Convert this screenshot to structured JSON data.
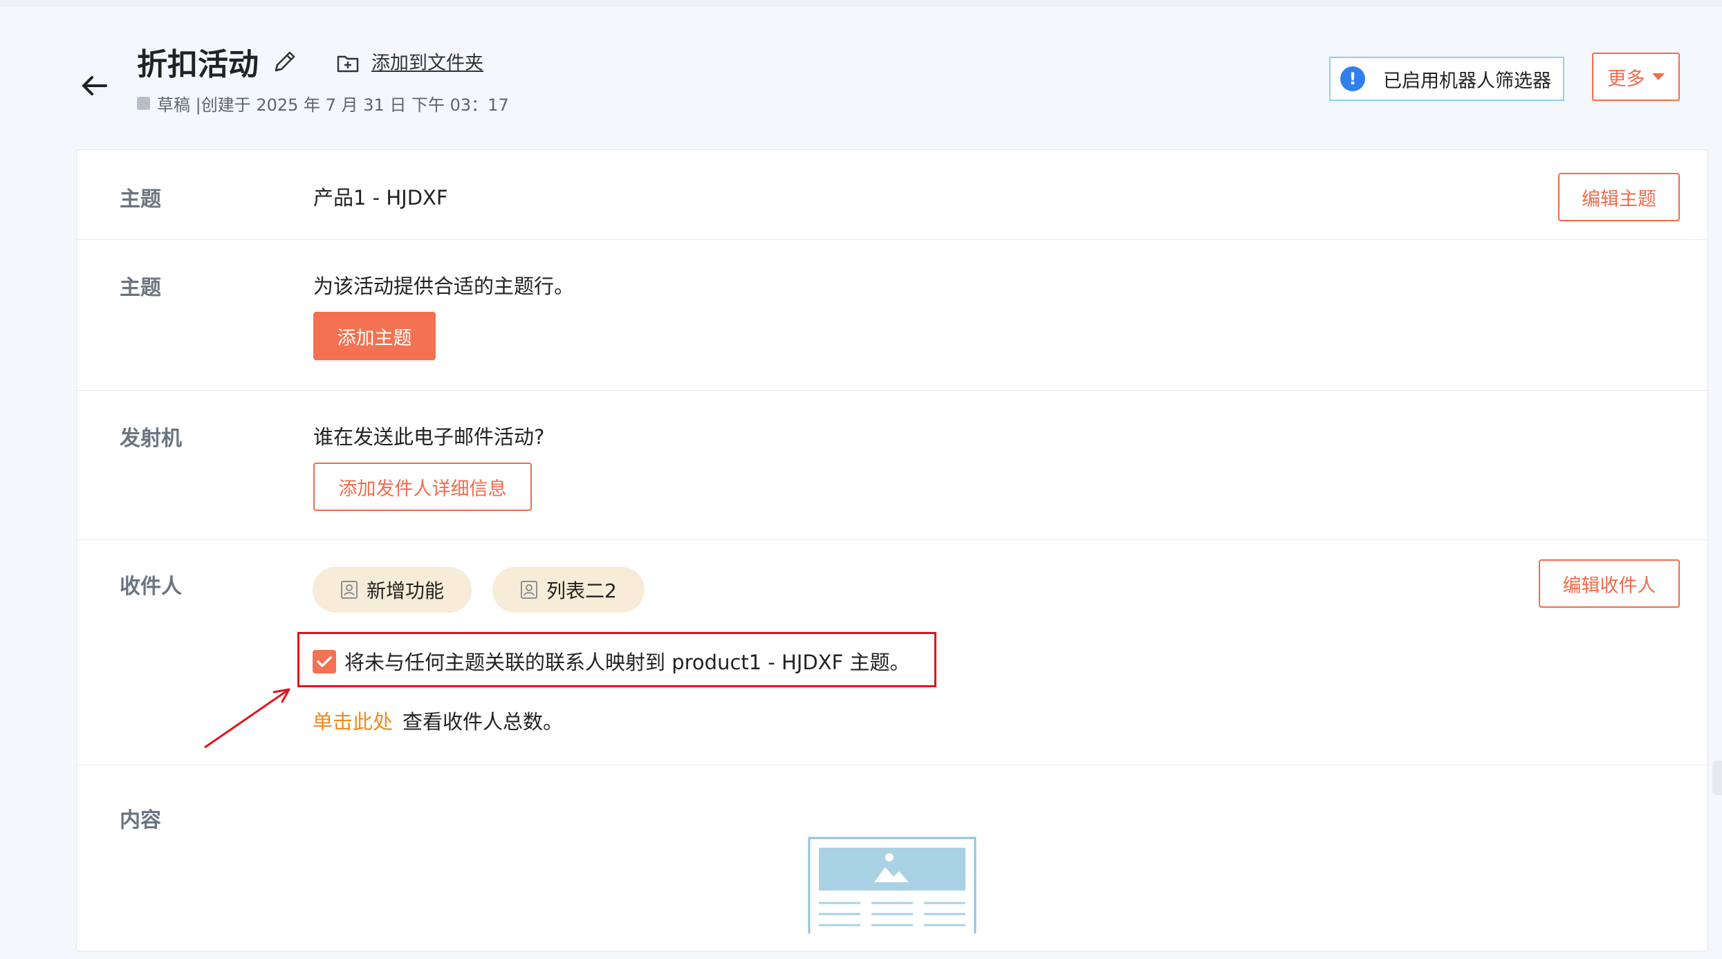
{
  "header": {
    "title": "折扣活动",
    "add_to_folder": "添加到文件夹",
    "status": "草稿 |创建于 2025 年 7 月 31 日 下午 03：17",
    "bot_filter": "已启用机器人筛选器",
    "more": "更多"
  },
  "sections": {
    "subject": {
      "label": "主题",
      "value": "产品1 - HJDXF",
      "edit_button": "编辑主题"
    },
    "subject_line": {
      "label": "主题",
      "prompt": "为该活动提供合适的主题行。",
      "add_button": "添加主题"
    },
    "sender": {
      "label": "发射机",
      "prompt": "谁在发送此电子邮件活动?",
      "add_button": "添加发件人详细信息"
    },
    "recipients": {
      "label": "收件人",
      "lists": [
        "新增功能",
        "列表二2"
      ],
      "edit_button": "编辑收件人",
      "checkbox_label": "将未与任何主题关联的联系人映射到 product1 - HJDXF 主题。",
      "checkbox_checked": true,
      "click_here": "单击此处",
      "click_suffix": "查看收件人总数。"
    },
    "content": {
      "label": "内容"
    }
  },
  "colors": {
    "accent": "#f26b4c",
    "accent_fill": "#f47152",
    "link_orange": "#f28a1c",
    "chip_bg": "#f6ecd7",
    "annotation_red": "#e0141b",
    "info_blue": "#2f80ed"
  },
  "icons": {
    "back": "arrow-left-icon",
    "edit": "pencil-icon",
    "folder": "folder-plus-icon",
    "info": "info-icon",
    "contact_list": "contact-list-icon",
    "check": "check-icon"
  }
}
